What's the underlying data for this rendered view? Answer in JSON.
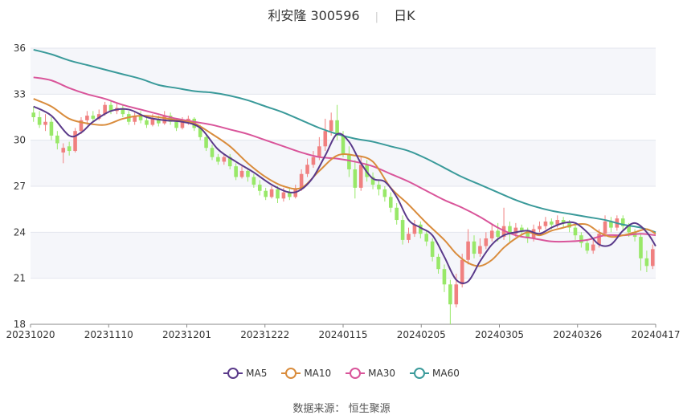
{
  "title": {
    "name": "利安隆",
    "code": "300596",
    "period": "日K"
  },
  "legend": [
    {
      "label": "MA5",
      "color": "#5a3a8a"
    },
    {
      "label": "MA10",
      "color": "#d98c3c"
    },
    {
      "label": "MA30",
      "color": "#d9559a"
    },
    {
      "label": "MA60",
      "color": "#3a9a9a"
    }
  ],
  "source": {
    "label": "数据来源：",
    "value": "恒生聚源"
  },
  "chart_data": {
    "type": "candlestick",
    "yaxis": {
      "min": 18,
      "max": 36,
      "ticks": [
        18,
        21,
        24,
        27,
        30,
        33,
        36
      ]
    },
    "xaxis": {
      "ticks": [
        "20231020",
        "20231110",
        "20231201",
        "20231222",
        "20240115",
        "20240205",
        "20240305",
        "20240326",
        "20240417"
      ]
    },
    "colors": {
      "up": "#f08080",
      "down": "#98e868",
      "grid_band": "#f5f6fa"
    },
    "candles": [
      [
        31.8,
        31.5,
        32.2,
        31.2
      ],
      [
        31.5,
        31.0,
        31.9,
        30.8
      ],
      [
        31.0,
        31.2,
        31.7,
        30.6
      ],
      [
        31.2,
        30.3,
        31.5,
        30.0
      ],
      [
        30.3,
        29.8,
        30.6,
        29.4
      ],
      [
        29.2,
        29.5,
        29.8,
        28.5
      ],
      [
        29.6,
        29.3,
        29.9,
        29.0
      ],
      [
        29.3,
        30.6,
        30.8,
        29.2
      ],
      [
        30.6,
        31.3,
        31.5,
        30.4
      ],
      [
        31.3,
        31.6,
        31.9,
        31.0
      ],
      [
        31.6,
        31.4,
        31.9,
        31.2
      ],
      [
        31.4,
        31.7,
        32.0,
        31.3
      ],
      [
        31.7,
        32.3,
        32.5,
        31.6
      ],
      [
        32.3,
        31.9,
        32.6,
        31.7
      ],
      [
        31.9,
        32.1,
        32.4,
        31.7
      ],
      [
        32.1,
        31.7,
        32.3,
        31.5
      ],
      [
        31.7,
        31.2,
        31.9,
        31.0
      ],
      [
        31.2,
        31.6,
        31.8,
        31.0
      ],
      [
        31.6,
        31.3,
        31.9,
        31.1
      ],
      [
        31.3,
        31.0,
        31.5,
        30.8
      ],
      [
        31.0,
        31.4,
        31.7,
        30.9
      ],
      [
        31.4,
        31.1,
        31.6,
        30.9
      ],
      [
        31.1,
        31.6,
        31.9,
        31.0
      ],
      [
        31.6,
        31.2,
        31.8,
        31.0
      ],
      [
        31.2,
        30.8,
        31.4,
        30.6
      ],
      [
        30.8,
        31.2,
        31.5,
        30.7
      ],
      [
        31.2,
        31.4,
        31.6,
        31.0
      ],
      [
        31.4,
        30.8,
        31.5,
        30.6
      ],
      [
        30.8,
        30.2,
        31.0,
        30.0
      ],
      [
        30.2,
        29.5,
        30.4,
        29.3
      ],
      [
        29.5,
        28.9,
        29.7,
        28.7
      ],
      [
        28.9,
        28.6,
        29.1,
        28.4
      ],
      [
        28.6,
        28.9,
        29.1,
        28.4
      ],
      [
        28.9,
        28.3,
        29.1,
        28.1
      ],
      [
        28.3,
        27.6,
        28.5,
        27.4
      ],
      [
        27.6,
        28.0,
        28.3,
        27.5
      ],
      [
        28.0,
        27.6,
        28.2,
        27.3
      ],
      [
        27.6,
        27.1,
        27.8,
        26.9
      ],
      [
        27.1,
        26.7,
        27.4,
        26.4
      ],
      [
        26.7,
        26.3,
        26.9,
        26.1
      ],
      [
        26.3,
        26.8,
        27.0,
        26.2
      ],
      [
        26.8,
        26.2,
        27.0,
        25.9
      ],
      [
        26.2,
        26.6,
        26.9,
        26.0
      ],
      [
        26.6,
        26.3,
        26.9,
        26.1
      ],
      [
        26.3,
        26.8,
        27.1,
        26.2
      ],
      [
        26.8,
        27.8,
        28.1,
        26.7
      ],
      [
        27.8,
        28.4,
        28.8,
        27.6
      ],
      [
        28.4,
        28.9,
        29.3,
        28.2
      ],
      [
        28.9,
        29.6,
        30.2,
        28.7
      ],
      [
        29.6,
        30.6,
        31.4,
        29.3
      ],
      [
        30.6,
        31.3,
        31.8,
        30.3
      ],
      [
        31.3,
        30.3,
        32.3,
        30.0
      ],
      [
        30.3,
        29.1,
        30.6,
        28.9
      ],
      [
        29.1,
        28.1,
        29.6,
        27.6
      ],
      [
        28.1,
        26.9,
        28.7,
        26.2
      ],
      [
        26.9,
        28.4,
        28.9,
        26.7
      ],
      [
        28.4,
        27.6,
        28.7,
        27.3
      ],
      [
        27.6,
        27.1,
        27.9,
        26.8
      ],
      [
        27.1,
        26.8,
        27.4,
        26.4
      ],
      [
        26.8,
        26.3,
        27.0,
        26.0
      ],
      [
        26.3,
        25.6,
        26.6,
        25.3
      ],
      [
        25.6,
        24.8,
        25.9,
        24.5
      ],
      [
        24.8,
        23.5,
        25.1,
        23.2
      ],
      [
        23.5,
        23.9,
        24.3,
        23.3
      ],
      [
        23.9,
        24.5,
        24.8,
        23.7
      ],
      [
        24.5,
        23.9,
        24.7,
        23.6
      ],
      [
        23.9,
        23.4,
        24.1,
        23.1
      ],
      [
        23.4,
        22.4,
        23.6,
        22.1
      ],
      [
        22.4,
        21.6,
        22.6,
        21.3
      ],
      [
        21.6,
        20.6,
        21.9,
        20.1
      ],
      [
        20.6,
        19.3,
        20.9,
        18.0
      ],
      [
        19.3,
        20.6,
        21.3,
        19.1
      ],
      [
        20.6,
        22.2,
        22.6,
        20.4
      ],
      [
        22.2,
        23.4,
        24.2,
        21.9
      ],
      [
        23.4,
        22.6,
        23.8,
        22.3
      ],
      [
        22.6,
        23.1,
        23.6,
        22.4
      ],
      [
        23.1,
        23.6,
        24.0,
        22.9
      ],
      [
        23.6,
        24.1,
        24.5,
        23.4
      ],
      [
        24.1,
        23.7,
        24.6,
        23.4
      ],
      [
        23.7,
        24.4,
        25.6,
        23.5
      ],
      [
        24.4,
        23.9,
        24.7,
        23.3
      ],
      [
        23.9,
        24.3,
        24.6,
        23.7
      ],
      [
        24.3,
        24.1,
        24.5,
        23.8
      ],
      [
        24.1,
        23.6,
        24.3,
        23.3
      ],
      [
        23.6,
        24.2,
        24.5,
        23.4
      ],
      [
        24.2,
        24.4,
        24.7,
        24.0
      ],
      [
        24.4,
        24.7,
        25.0,
        24.2
      ],
      [
        24.7,
        24.5,
        24.9,
        24.2
      ],
      [
        24.5,
        24.8,
        25.1,
        24.3
      ],
      [
        24.8,
        24.6,
        25.0,
        24.3
      ],
      [
        24.6,
        24.3,
        24.8,
        24.0
      ],
      [
        24.3,
        23.8,
        24.5,
        23.5
      ],
      [
        23.8,
        23.3,
        24.0,
        23.0
      ],
      [
        23.3,
        22.8,
        23.5,
        22.6
      ],
      [
        22.8,
        23.2,
        23.5,
        22.6
      ],
      [
        23.2,
        23.9,
        24.2,
        23.0
      ],
      [
        23.9,
        24.7,
        25.1,
        23.7
      ],
      [
        24.7,
        24.3,
        25.0,
        24.0
      ],
      [
        24.3,
        24.9,
        25.1,
        24.1
      ],
      [
        24.9,
        24.4,
        25.1,
        24.1
      ],
      [
        24.4,
        24.0,
        24.6,
        23.7
      ],
      [
        24.0,
        23.7,
        24.2,
        23.4
      ],
      [
        23.7,
        22.3,
        23.9,
        21.5
      ],
      [
        22.3,
        21.8,
        22.8,
        21.4
      ],
      [
        21.8,
        22.9,
        23.2,
        21.6
      ]
    ],
    "ma": {
      "MA5": [
        [
          0,
          32.2
        ],
        [
          3,
          31.6
        ],
        [
          6,
          30.3
        ],
        [
          8,
          30.5
        ],
        [
          10,
          31.2
        ],
        [
          13,
          31.9
        ],
        [
          16,
          32.0
        ],
        [
          19,
          31.5
        ],
        [
          22,
          31.3
        ],
        [
          25,
          31.2
        ],
        [
          28,
          30.8
        ],
        [
          31,
          29.4
        ],
        [
          34,
          28.6
        ],
        [
          37,
          27.9
        ],
        [
          40,
          27.1
        ],
        [
          43,
          26.6
        ],
        [
          45,
          26.8
        ],
        [
          47,
          27.6
        ],
        [
          49,
          29.0
        ],
        [
          51,
          30.4
        ],
        [
          53,
          29.9
        ],
        [
          55,
          28.5
        ],
        [
          57,
          27.5
        ],
        [
          59,
          27.3
        ],
        [
          61,
          26.3
        ],
        [
          63,
          24.8
        ],
        [
          65,
          24.3
        ],
        [
          67,
          23.8
        ],
        [
          69,
          22.4
        ],
        [
          71,
          20.9
        ],
        [
          73,
          20.8
        ],
        [
          75,
          22.1
        ],
        [
          77,
          23.2
        ],
        [
          79,
          23.8
        ],
        [
          81,
          24.0
        ],
        [
          83,
          24.1
        ],
        [
          85,
          23.9
        ],
        [
          87,
          24.3
        ],
        [
          89,
          24.6
        ],
        [
          91,
          24.6
        ],
        [
          93,
          24.0
        ],
        [
          95,
          23.2
        ],
        [
          97,
          23.2
        ],
        [
          99,
          24.1
        ],
        [
          101,
          24.6
        ],
        [
          103,
          24.0
        ],
        [
          105,
          23.1
        ]
      ],
      "MA10": [
        [
          0,
          32.7
        ],
        [
          3,
          32.2
        ],
        [
          6,
          31.4
        ],
        [
          9,
          31.1
        ],
        [
          12,
          31.0
        ],
        [
          15,
          31.4
        ],
        [
          18,
          31.6
        ],
        [
          21,
          31.5
        ],
        [
          24,
          31.3
        ],
        [
          27,
          31.1
        ],
        [
          30,
          30.4
        ],
        [
          33,
          29.6
        ],
        [
          36,
          28.5
        ],
        [
          39,
          27.6
        ],
        [
          42,
          27.0
        ],
        [
          45,
          26.9
        ],
        [
          48,
          28.0
        ],
        [
          51,
          29.0
        ],
        [
          54,
          29.0
        ],
        [
          57,
          28.6
        ],
        [
          60,
          26.9
        ],
        [
          63,
          25.8
        ],
        [
          66,
          24.6
        ],
        [
          69,
          23.5
        ],
        [
          71,
          22.6
        ],
        [
          73,
          22.0
        ],
        [
          75,
          21.8
        ],
        [
          77,
          22.2
        ],
        [
          79,
          23.0
        ],
        [
          81,
          23.6
        ],
        [
          83,
          24.0
        ],
        [
          85,
          23.8
        ],
        [
          87,
          24.1
        ],
        [
          89,
          24.3
        ],
        [
          91,
          24.5
        ],
        [
          93,
          24.5
        ],
        [
          95,
          24.0
        ],
        [
          97,
          23.7
        ],
        [
          99,
          23.8
        ],
        [
          101,
          24.0
        ],
        [
          103,
          24.2
        ],
        [
          105,
          23.9
        ]
      ],
      "MA30": [
        [
          0,
          34.1
        ],
        [
          3,
          33.9
        ],
        [
          6,
          33.4
        ],
        [
          9,
          33.0
        ],
        [
          12,
          32.7
        ],
        [
          15,
          32.3
        ],
        [
          18,
          32.0
        ],
        [
          21,
          31.7
        ],
        [
          24,
          31.4
        ],
        [
          27,
          31.2
        ],
        [
          30,
          31.0
        ],
        [
          33,
          30.7
        ],
        [
          36,
          30.4
        ],
        [
          39,
          30.0
        ],
        [
          42,
          29.6
        ],
        [
          45,
          29.2
        ],
        [
          48,
          28.9
        ],
        [
          51,
          28.8
        ],
        [
          54,
          28.6
        ],
        [
          57,
          28.3
        ],
        [
          60,
          27.8
        ],
        [
          63,
          27.3
        ],
        [
          66,
          26.7
        ],
        [
          69,
          26.1
        ],
        [
          72,
          25.6
        ],
        [
          75,
          25.0
        ],
        [
          78,
          24.3
        ],
        [
          81,
          23.8
        ],
        [
          84,
          23.6
        ],
        [
          87,
          23.4
        ],
        [
          90,
          23.4
        ],
        [
          93,
          23.5
        ],
        [
          96,
          23.8
        ],
        [
          99,
          23.8
        ],
        [
          102,
          23.9
        ],
        [
          105,
          23.8
        ]
      ],
      "MA60": [
        [
          0,
          35.9
        ],
        [
          3,
          35.6
        ],
        [
          6,
          35.2
        ],
        [
          9,
          34.9
        ],
        [
          12,
          34.6
        ],
        [
          15,
          34.3
        ],
        [
          18,
          34.0
        ],
        [
          21,
          33.6
        ],
        [
          24,
          33.4
        ],
        [
          27,
          33.2
        ],
        [
          30,
          33.1
        ],
        [
          33,
          32.9
        ],
        [
          36,
          32.6
        ],
        [
          39,
          32.2
        ],
        [
          42,
          31.8
        ],
        [
          45,
          31.3
        ],
        [
          48,
          30.8
        ],
        [
          51,
          30.4
        ],
        [
          54,
          30.1
        ],
        [
          57,
          29.9
        ],
        [
          60,
          29.6
        ],
        [
          63,
          29.3
        ],
        [
          66,
          28.8
        ],
        [
          69,
          28.2
        ],
        [
          72,
          27.6
        ],
        [
          75,
          27.1
        ],
        [
          78,
          26.6
        ],
        [
          81,
          26.1
        ],
        [
          84,
          25.7
        ],
        [
          87,
          25.4
        ],
        [
          90,
          25.2
        ],
        [
          93,
          25.0
        ],
        [
          96,
          24.8
        ],
        [
          99,
          24.5
        ],
        [
          102,
          24.3
        ],
        [
          105,
          24.0
        ]
      ]
    }
  }
}
